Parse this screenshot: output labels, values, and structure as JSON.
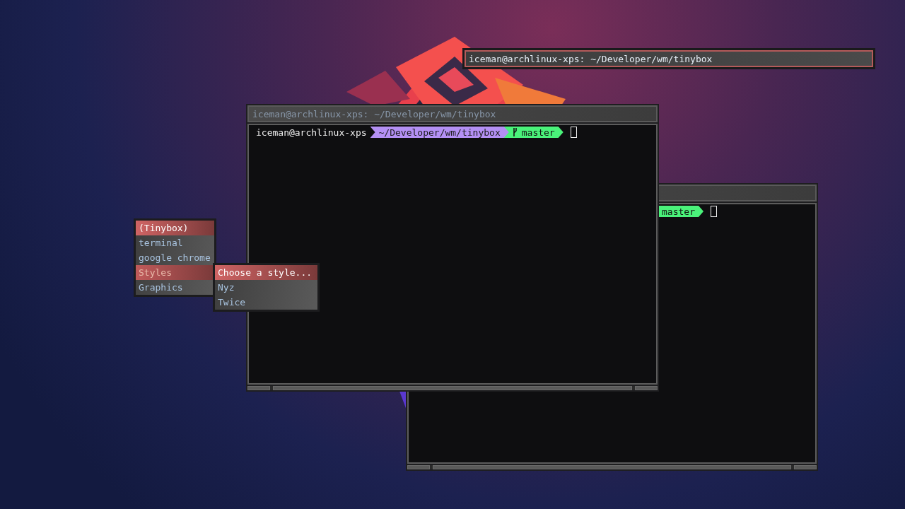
{
  "top_bar": {
    "title": "iceman@archlinux-xps: ~/Developer/wm/tinybox"
  },
  "back_terminal": {
    "branch": "master"
  },
  "front_terminal": {
    "title": "iceman@archlinux-xps: ~/Developer/wm/tinybox",
    "user": "iceman@archlinux-xps",
    "path": "~/Developer/wm/tinybox",
    "branch": "master"
  },
  "menu": {
    "items": [
      {
        "label": "(Tinybox)",
        "kind": "title",
        "selected": false
      },
      {
        "label": "terminal",
        "kind": "item",
        "selected": false
      },
      {
        "label": "google chrome",
        "kind": "item",
        "selected": false
      },
      {
        "label": "Styles",
        "kind": "item",
        "selected": true
      },
      {
        "label": "Graphics",
        "kind": "item",
        "selected": false
      }
    ]
  },
  "submenu": {
    "items": [
      {
        "label": "Choose a style...",
        "kind": "title",
        "selected": false
      },
      {
        "label": "Nyz",
        "kind": "item",
        "selected": false
      },
      {
        "label": "Twice",
        "kind": "item",
        "selected": false
      }
    ]
  }
}
